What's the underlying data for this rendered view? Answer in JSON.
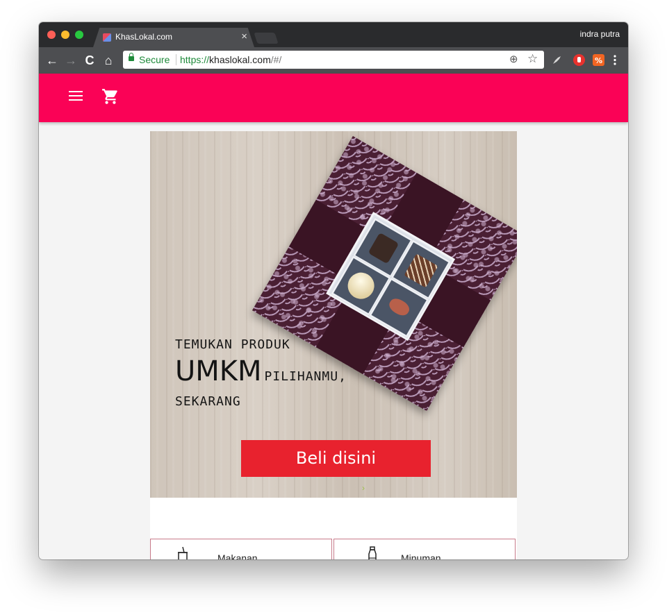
{
  "browser": {
    "tab_title": "KhasLokal.com",
    "tab_close": "×",
    "profile_name": "indra putra",
    "secure_label": "Secure",
    "url_scheme": "https://",
    "url_host": "khaslokal.com",
    "url_path": "/#/",
    "nav": {
      "back": "←",
      "forward": "→",
      "reload": "C",
      "home": "⌂"
    },
    "omnibox_icons": {
      "zoom": "⊕",
      "bookmark": "☆"
    },
    "extensions": [
      "rocket-icon",
      "adblock-icon",
      "extension-icon",
      "more-icon"
    ]
  },
  "app": {
    "brand_color": "#fa0256",
    "menu_icon": "menu-icon",
    "cart_icon": "cart-icon"
  },
  "hero": {
    "line1": "TEMUKAN PRODUK",
    "big_word": "UMKM",
    "small_word": "PILIHANMU,",
    "line3": "SEKARANG",
    "cta_label": "Beli disini",
    "cta_color": "#e8222e",
    "next_arrow": "›"
  },
  "categories": [
    {
      "label": "Makanan",
      "icon": "food-icon"
    },
    {
      "label": "Minuman",
      "icon": "bottle-icon"
    }
  ]
}
